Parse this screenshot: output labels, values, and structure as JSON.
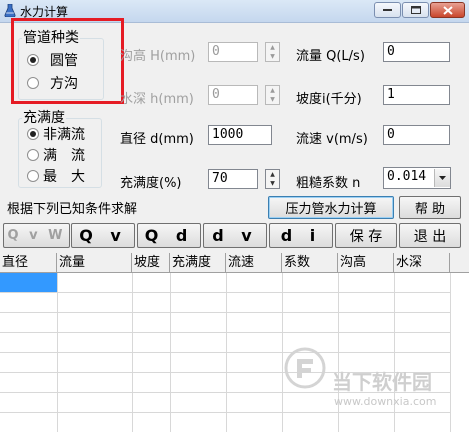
{
  "window": {
    "title": "水力计算"
  },
  "pipe_type": {
    "title": "管道种类",
    "options": [
      {
        "label": "圆管",
        "selected": true
      },
      {
        "label": "方沟",
        "selected": false
      }
    ]
  },
  "fullness": {
    "title": "充满度",
    "options": [
      {
        "label": "非满流",
        "selected": true
      },
      {
        "label": "满　流",
        "selected": false
      },
      {
        "label": "最　大",
        "selected": false
      }
    ]
  },
  "fields": {
    "ditch_height": {
      "label": "沟高 H(mm)",
      "value": "0"
    },
    "water_depth": {
      "label": "水深 h(mm)",
      "value": "0"
    },
    "diameter": {
      "label": "直径 d(mm)",
      "value": "1000"
    },
    "fullness_pct": {
      "label": "充满度(%)",
      "value": "70"
    },
    "flow": {
      "label": "流量 Q(L/s)",
      "value": "0"
    },
    "slope": {
      "label": "坡度i(千分)",
      "value": "1"
    },
    "velocity": {
      "label": "流速 v(m/s)",
      "value": "0"
    },
    "roughness": {
      "label": "粗糙系数 n",
      "value": "0.014"
    }
  },
  "hint": "根据下列已知条件求解",
  "buttons": {
    "pressure_calc": "压力管水力计算",
    "help": "帮 助",
    "qvw": "Q v W",
    "qv": "Q v",
    "qd": "Q d",
    "dv": "d v",
    "di": "d i",
    "save": "保 存",
    "exit": "退 出"
  },
  "table": {
    "columns": [
      "直径",
      "流量",
      "坡度",
      "充满度",
      "流速",
      "系数",
      "沟高",
      "水深"
    ]
  },
  "watermark": {
    "name": "当下软件园",
    "url": "www.downxia.com"
  },
  "colors": {
    "highlight": "#e51b24",
    "selection": "#3399ff",
    "titlebar": "#c5d7ee"
  }
}
